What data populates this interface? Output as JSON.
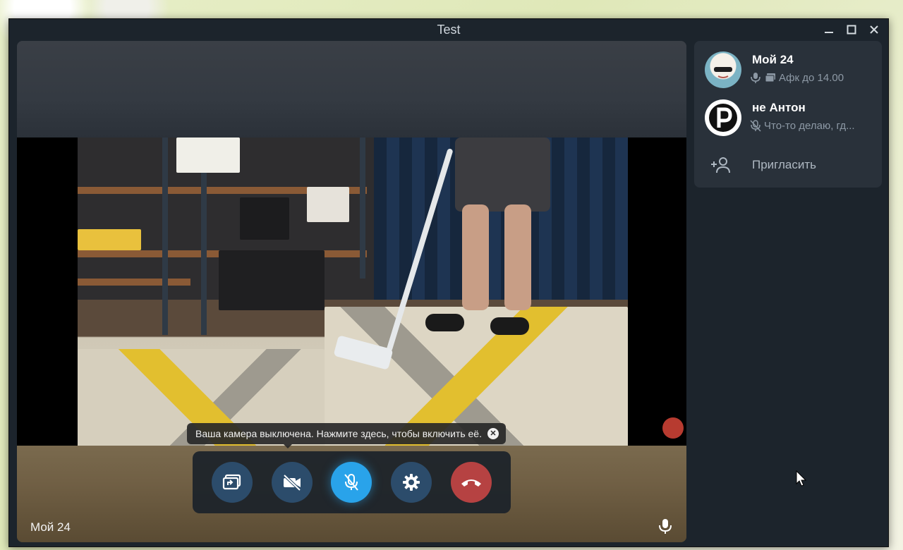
{
  "window": {
    "title": "Test"
  },
  "video": {
    "participant_name": "Мой 24",
    "camera_tooltip": "Ваша камера выключена. Нажмите здесь, чтобы включить её."
  },
  "controls": {
    "buttons": [
      {
        "name": "screen-share",
        "icon": "screen-share-icon"
      },
      {
        "name": "camera-toggle",
        "icon": "camera-off-icon"
      },
      {
        "name": "mic-toggle",
        "icon": "mic-off-icon",
        "active": true
      },
      {
        "name": "settings",
        "icon": "gear-icon"
      },
      {
        "name": "end-call",
        "icon": "phone-hangup-icon"
      }
    ],
    "colors": {
      "dark_button": "#2c4c6b",
      "mic_active": "#29a3ea",
      "end_call": "#b64242"
    }
  },
  "sidebar": {
    "members": [
      {
        "name": "Мой 24",
        "status": "Афк до 14.00"
      },
      {
        "name": "не Антон",
        "status": "Что-то делаю, гд..."
      }
    ],
    "invite_label": "Пригласить"
  }
}
